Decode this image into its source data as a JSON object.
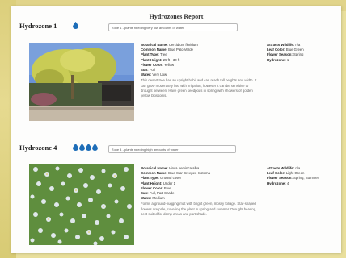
{
  "report_title": "Hydrozones Report",
  "colors": {
    "drop": "#1d6db8",
    "page": "#fdfdfc",
    "background": "#e9df9c"
  },
  "zones": [
    {
      "title": "Hydrozone 1",
      "drop_count": 1,
      "select_value": "Zone 1 - plants needing very low amounts of water",
      "photo_icon": "tree-photo",
      "details": [
        {
          "label": "Botanical Name:",
          "value": "Cercidium floridum"
        },
        {
          "label": "Common Name:",
          "value": "Blue Palo Verde"
        },
        {
          "label": "Plant Type:",
          "value": "Tree"
        },
        {
          "label": "Plant Height:",
          "value": "25 ft - 30 ft"
        },
        {
          "label": "Flower Color:",
          "value": "Yellow"
        },
        {
          "label": "Sun:",
          "value": "Full"
        },
        {
          "label": "Water:",
          "value": "Very Low"
        }
      ],
      "description": "This desert tree has an upright habit and can reach tall heights and width. It can grow moderately fast with irrigation, however it can be sensitive to drought between. Have green seedpods in spring with showers of golden yellow blossoms.",
      "right": [
        {
          "label": "Attracts Wildlife:",
          "value": "n/a"
        },
        {
          "label": "Leaf Color:",
          "value": "Blue Green"
        },
        {
          "label": "Flower Season:",
          "value": "Spring"
        },
        {
          "label": "Hydrozone:",
          "value": "1"
        }
      ]
    },
    {
      "title": "Hydrozone 4",
      "drop_count": 4,
      "select_value": "Zone 4 - plants needing high amounts of water",
      "photo_icon": "flower-photo",
      "details": [
        {
          "label": "Botanical Name:",
          "value": "Vinca pervinca alba"
        },
        {
          "label": "Common Name:",
          "value": "Blue Star Creeper, Isotoma"
        },
        {
          "label": "Plant Type:",
          "value": "Ground cover"
        },
        {
          "label": "Plant Height:",
          "value": "Under 1"
        },
        {
          "label": "Flower Color:",
          "value": "Blue"
        },
        {
          "label": "Sun:",
          "value": "Full, Part Shade"
        },
        {
          "label": "Water:",
          "value": "Medium"
        }
      ],
      "description": "Forms a ground-hugging mat with bright green, mossy foliage. Star-shaped flowers are pale, covering the plant in spring and summer. Drought bearing, best suited for damp areas and part shade.",
      "right": [
        {
          "label": "Attracts Wildlife:",
          "value": "n/a"
        },
        {
          "label": "Leaf Color:",
          "value": "Light Green"
        },
        {
          "label": "Flower Season:",
          "value": "Spring, Summer"
        },
        {
          "label": "Hydrozone:",
          "value": "4"
        }
      ]
    }
  ]
}
